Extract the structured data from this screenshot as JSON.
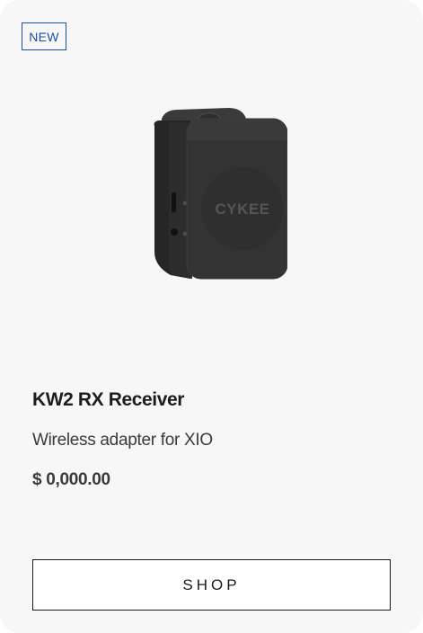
{
  "card": {
    "badge": "NEW",
    "image": {
      "device_logo_text": "CYKEE"
    },
    "title": "KW2 RX Receiver",
    "subtitle": "Wireless adapter for XIO",
    "price": "$ 0,000.00",
    "button_label": "SHOP"
  },
  "colors": {
    "badge": "#1f4f9a",
    "card_bg": "#f7f7f7",
    "text": "#1d1d1d",
    "button_border": "#1a1a1a"
  }
}
